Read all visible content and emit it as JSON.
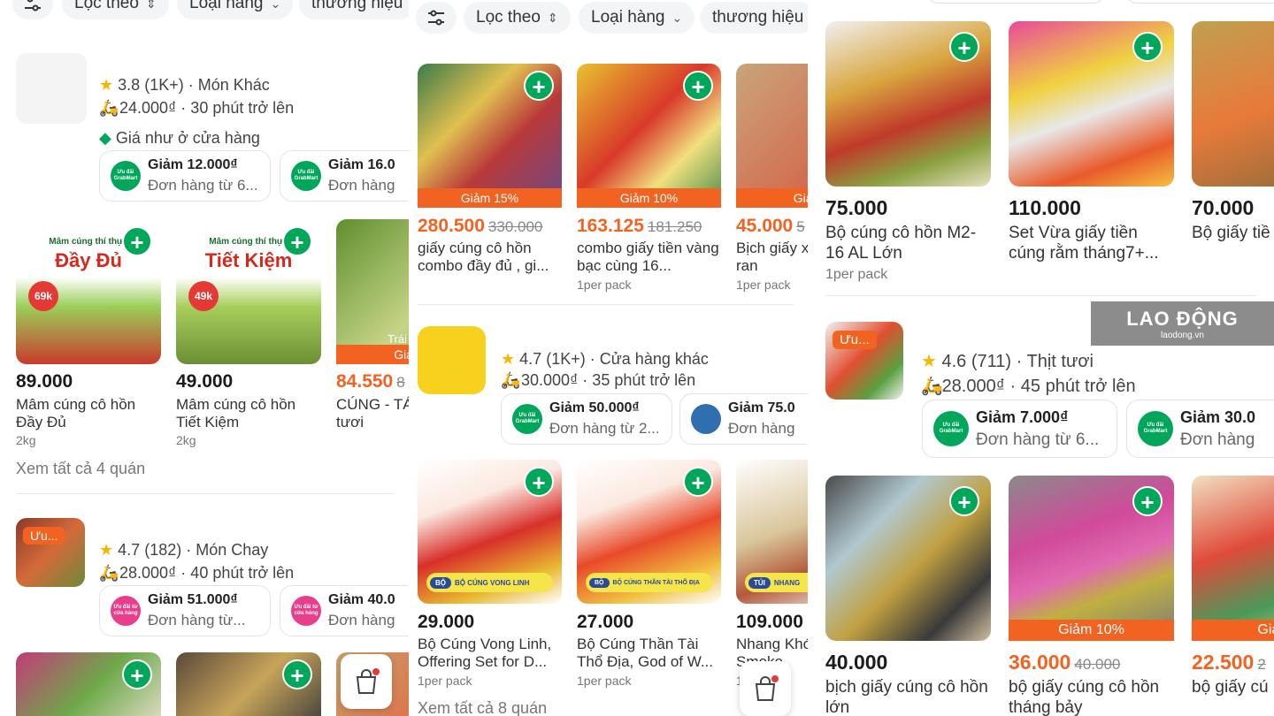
{
  "filters": {
    "sort_label": "Lọc theo",
    "type_label": "Loại hàng",
    "brand_label": "thương hiệu"
  },
  "panel1": {
    "store1": {
      "rating": "3.8",
      "reviews": "(1K+)",
      "category": "· Món Khác",
      "delivery": "24.000₫ · 30 phút trở lên",
      "store_price_note": "Giá như ở cửa hàng",
      "coupons": [
        {
          "badge": "Ưu đãi GrabMart",
          "title": "Giảm 12.000₫",
          "sub": "Đơn hàng từ 6..."
        },
        {
          "badge": "Ưu đãi GrabMart",
          "title": "Giảm 16.0",
          "sub": "Đơn hàng"
        }
      ],
      "items": [
        {
          "price": "89.000",
          "name": "Mâm cúng cô hồn Đầy Đủ",
          "unit": "2kg",
          "img_label": "Đầy Đủ",
          "img_top": "Mâm cúng thí thực",
          "img_price": "69k"
        },
        {
          "price": "49.000",
          "name": "Mâm cúng cô hồn Tiết Kiệm",
          "unit": "2kg",
          "img_label": "Tiết Kiệm",
          "img_top": "Mâm cúng thí thực",
          "img_price": "49k"
        },
        {
          "price": "84.550",
          "old": "8",
          "name": "CÚNG - TÁ (Hàng tươi",
          "unit": "",
          "disc": "Giảm",
          "img_label": "Trái"
        }
      ],
      "see_all": "Xem tất cả 4 quán"
    },
    "store2": {
      "badge": "Ưu...",
      "rating": "4.7",
      "reviews": "(182)",
      "category": "· Món Chay",
      "delivery": "28.000₫ · 40 phút trở lên",
      "coupons": [
        {
          "badge": "Ưu đãi từ cửa hàng",
          "title": "Giảm 51.000₫",
          "sub": "Đơn hàng từ..."
        },
        {
          "badge": "Ưu đãi từ cửa hàng",
          "title": "Giảm 40.0",
          "sub": "Đơn hàng"
        }
      ]
    }
  },
  "panel2": {
    "items1": [
      {
        "price": "280.500",
        "old": "330.000",
        "disc": "Giảm 15%",
        "name": "giấy cúng cô hồn combo đầy đủ , gi...",
        "unit": ""
      },
      {
        "price": "163.125",
        "old": "181.250",
        "disc": "Giảm 10%",
        "name": "combo giấy tiền vàng bạc cùng 16...",
        "unit": "1per pack"
      },
      {
        "price": "45.000",
        "old": "5",
        "disc": "Giảm",
        "name": "Bịch giấy x cô hồn ran",
        "unit": "1per pack"
      }
    ],
    "store": {
      "rating": "4.7",
      "reviews": "(1K+)",
      "category": "· Cửa hàng khác",
      "delivery": "30.000₫ · 35 phút trở lên",
      "coupons": [
        {
          "badge": "Ưu đãi GrabMart",
          "title": "Giảm 50.000₫",
          "sub": "Đơn hàng từ 2..."
        },
        {
          "badge": "",
          "title": "Giảm 75.0",
          "sub": "Đơn hàng"
        }
      ]
    },
    "items2": [
      {
        "price": "29.000",
        "name": "Bộ Cúng Vong Linh, Offering Set for D...",
        "unit": "1per pack",
        "tag": "BỘ",
        "tag_text": "BỘ CÚNG VONG LINH"
      },
      {
        "price": "27.000",
        "name": "Bộ Cúng Thần Tài Thổ Địa, God of W...",
        "unit": "1per pack",
        "tag": "BỘ",
        "tag_text": "BỘ CÚNG THẦN TÀI THỔ ĐỊA"
      },
      {
        "price": "109.000",
        "name": "Nhang Khó Túi, Smoke",
        "unit": "1",
        "tag": "TÚI",
        "tag_text": "NHANG"
      }
    ],
    "see_all": "Xem tất cả 8 quán"
  },
  "panel3": {
    "items1": [
      {
        "price": "75.000",
        "name": "Bộ cúng cô hồn M2-16 AL Lớn",
        "unit": "1per pack"
      },
      {
        "price": "110.000",
        "name": "Set Vừa giấy tiền cúng rằm tháng7+...",
        "unit": ""
      },
      {
        "price": "70.000",
        "name": "Bộ giấy tiề cúng Ông",
        "unit": ""
      }
    ],
    "watermark": {
      "title": "LAO ĐỘNG",
      "sub": "laodong.vn"
    },
    "store": {
      "badge": "Ưu...",
      "rating": "4.6",
      "reviews": "(711)",
      "category": "· Thịt tươi",
      "delivery": "28.000₫ · 45 phút trở lên",
      "coupons": [
        {
          "badge": "Ưu đãi GrabMart",
          "title": "Giảm 7.000₫",
          "sub": "Đơn hàng từ 6..."
        },
        {
          "badge": "Ưu đãi GrabMart",
          "title": "Giảm 30.0",
          "sub": "Đơn hàng"
        }
      ]
    },
    "items2": [
      {
        "price": "40.000",
        "name": "bịch giấy cúng cô hồn lớn",
        "disc": ""
      },
      {
        "price": "36.000",
        "old": "40.000",
        "name": "bộ giấy cúng cô hồn tháng bảy",
        "disc": "Giảm 10%"
      },
      {
        "price": "22.500",
        "old": "2",
        "name": "bộ giấy cú",
        "disc": "Giảm"
      }
    ]
  },
  "colors": {
    "accent": "#00a65a",
    "discount": "#f26322",
    "star": "#f5b800"
  }
}
